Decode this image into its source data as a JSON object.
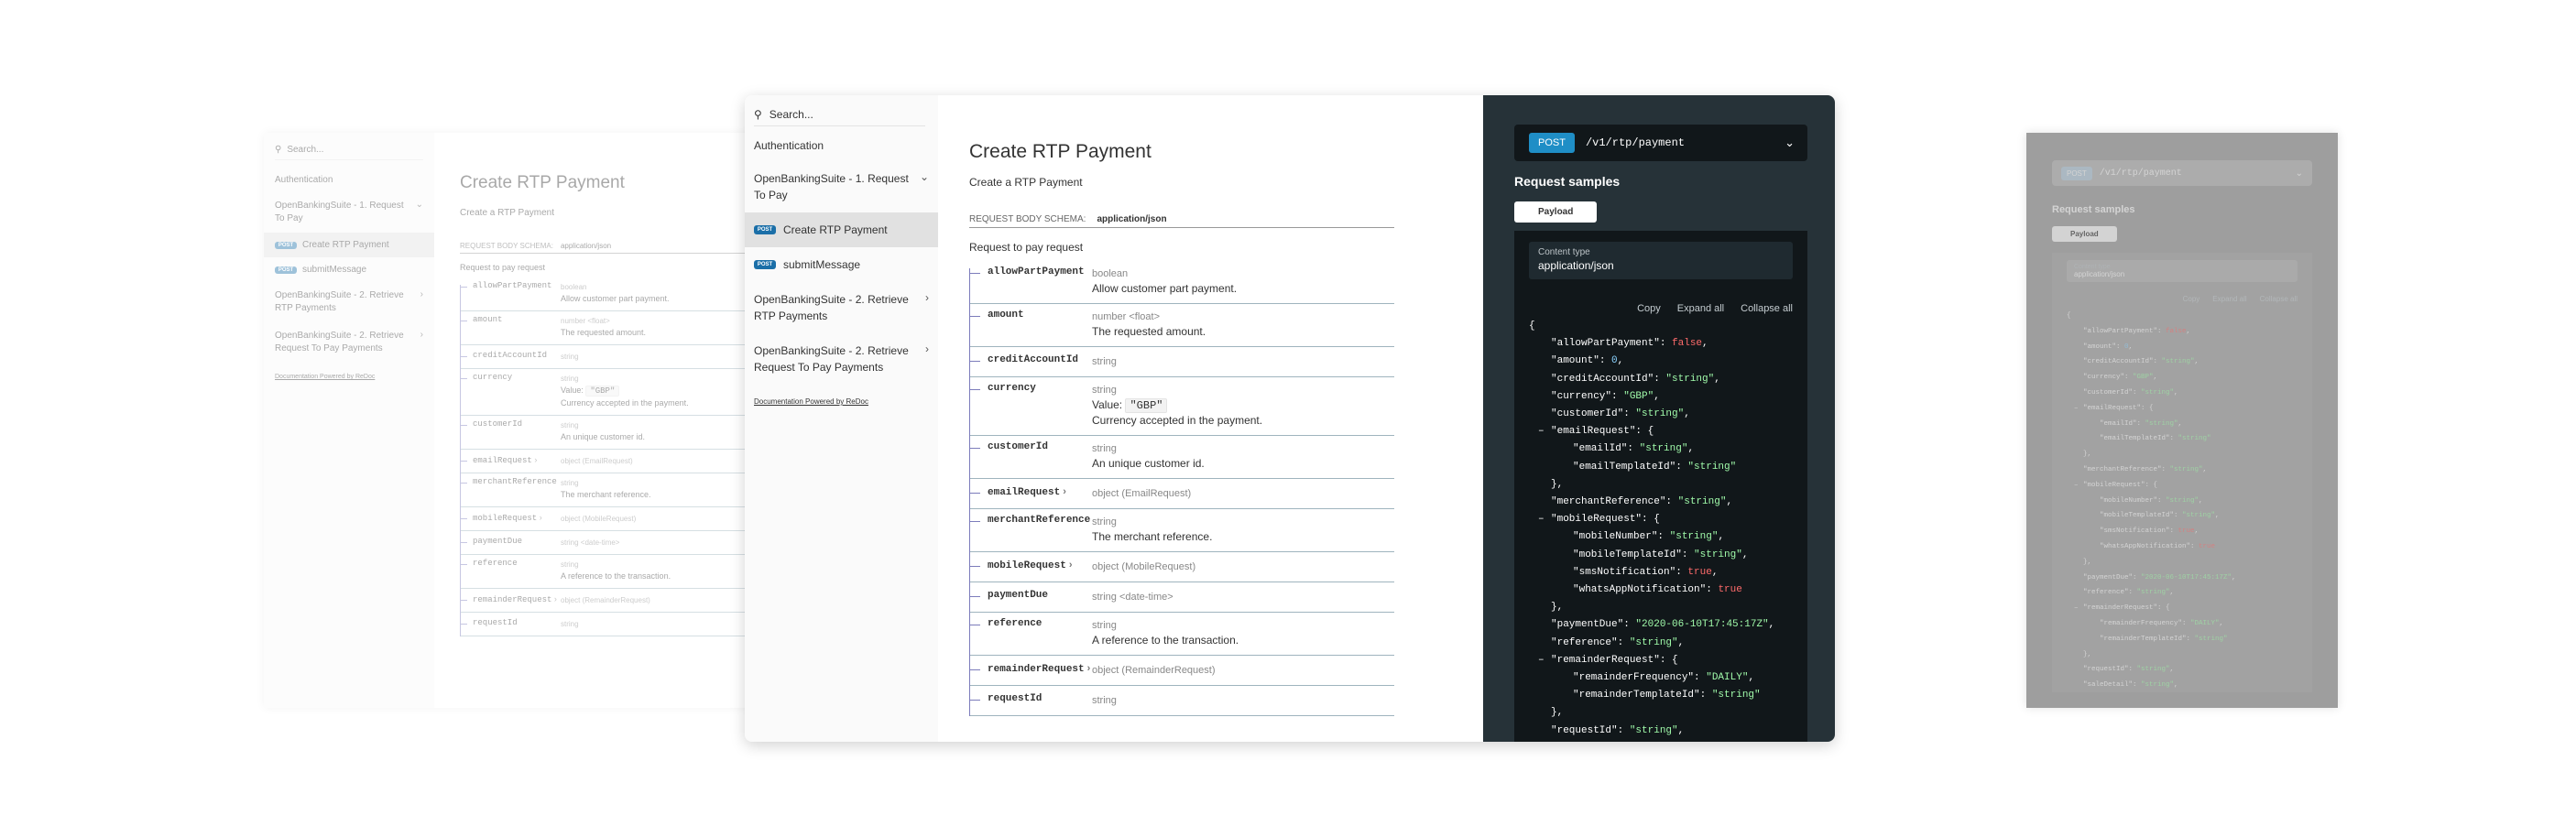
{
  "search_placeholder": "Search...",
  "menu": {
    "authentication": "Authentication",
    "group1": "OpenBankingSuite - 1. Request To Pay",
    "create_rtp": "Create RTP Payment",
    "submit_message": "submitMessage",
    "group2a": "OpenBankingSuite - 2. Retrieve RTP Payments",
    "group2b": "OpenBankingSuite - 2. Retrieve Request To Pay Payments",
    "post_badge": "POST",
    "powered_by": "Documentation Powered by ReDoc"
  },
  "main": {
    "title": "Create RTP Payment",
    "subtitle": "Create a RTP Payment",
    "schema_label": "REQUEST BODY SCHEMA:",
    "schema_value": "application/json",
    "request_desc": "Request to pay request",
    "props": [
      {
        "name": "allowPartPayment",
        "type": "boolean",
        "desc": "Allow customer part payment."
      },
      {
        "name": "amount",
        "type": "number <float>",
        "desc": "The requested amount."
      },
      {
        "name": "creditAccountId",
        "type": "string",
        "desc": ""
      },
      {
        "name": "currency",
        "type": "string",
        "value_label": "Value:",
        "value": "\"GBP\"",
        "desc": "Currency accepted in the payment."
      },
      {
        "name": "customerId",
        "type": "string",
        "desc": "An unique customer id."
      },
      {
        "name": "emailRequest",
        "type": "object (EmailRequest)",
        "desc": ""
      },
      {
        "name": "merchantReference",
        "type": "string",
        "desc": "The merchant reference."
      },
      {
        "name": "mobileRequest",
        "type": "object (MobileRequest)",
        "desc": ""
      },
      {
        "name": "paymentDue",
        "type": "string <date-time>",
        "desc": ""
      },
      {
        "name": "reference",
        "type": "string",
        "desc": "A reference to the transaction."
      },
      {
        "name": "remainderRequest",
        "type": "object (RemainderRequest)",
        "desc": ""
      },
      {
        "name": "requestId",
        "type": "string",
        "desc": ""
      }
    ]
  },
  "panel": {
    "method": "POST",
    "path": "/v1/rtp/payment",
    "samples_title": "Request samples",
    "tab": "Payload",
    "content_type_label": "Content type",
    "content_type": "application/json",
    "copy": "Copy",
    "expand_all": "Expand all",
    "collapse_all": "Collapse all"
  },
  "json_lines": [
    {
      "i": 0,
      "t": "{"
    },
    {
      "i": 1,
      "k": "\"allowPartPayment\"",
      "v": "false",
      "vt": "b",
      "comma": true
    },
    {
      "i": 1,
      "k": "\"amount\"",
      "v": "0",
      "vt": "n",
      "comma": true
    },
    {
      "i": 1,
      "k": "\"creditAccountId\"",
      "v": "\"string\"",
      "vt": "s",
      "comma": true
    },
    {
      "i": 1,
      "k": "\"currency\"",
      "v": "\"GBP\"",
      "vt": "s",
      "comma": true
    },
    {
      "i": 1,
      "k": "\"customerId\"",
      "v": "\"string\"",
      "vt": "s",
      "comma": true
    },
    {
      "i": 1,
      "toggle": true,
      "k": "\"emailRequest\"",
      "v": "{",
      "vt": "p"
    },
    {
      "i": 2,
      "k": "\"emailId\"",
      "v": "\"string\"",
      "vt": "s",
      "comma": true
    },
    {
      "i": 2,
      "k": "\"emailTemplateId\"",
      "v": "\"string\"",
      "vt": "s"
    },
    {
      "i": 1,
      "t": "},"
    },
    {
      "i": 1,
      "k": "\"merchantReference\"",
      "v": "\"string\"",
      "vt": "s",
      "comma": true
    },
    {
      "i": 1,
      "toggle": true,
      "k": "\"mobileRequest\"",
      "v": "{",
      "vt": "p"
    },
    {
      "i": 2,
      "k": "\"mobileNumber\"",
      "v": "\"string\"",
      "vt": "s",
      "comma": true
    },
    {
      "i": 2,
      "k": "\"mobileTemplateId\"",
      "v": "\"string\"",
      "vt": "s",
      "comma": true
    },
    {
      "i": 2,
      "k": "\"smsNotification\"",
      "v": "true",
      "vt": "b",
      "comma": true
    },
    {
      "i": 2,
      "k": "\"whatsAppNotification\"",
      "v": "true",
      "vt": "b"
    },
    {
      "i": 1,
      "t": "},"
    },
    {
      "i": 1,
      "k": "\"paymentDue\"",
      "v": "\"2020-06-10T17:45:17Z\"",
      "vt": "s",
      "comma": true
    },
    {
      "i": 1,
      "k": "\"reference\"",
      "v": "\"string\"",
      "vt": "s",
      "comma": true
    },
    {
      "i": 1,
      "toggle": true,
      "k": "\"remainderRequest\"",
      "v": "{",
      "vt": "p"
    },
    {
      "i": 2,
      "k": "\"remainderFrequency\"",
      "v": "\"DAILY\"",
      "vt": "s",
      "comma": true
    },
    {
      "i": 2,
      "k": "\"remainderTemplateId\"",
      "v": "\"string\"",
      "vt": "s"
    },
    {
      "i": 1,
      "t": "},"
    },
    {
      "i": 1,
      "k": "\"requestId\"",
      "v": "\"string\"",
      "vt": "s",
      "comma": true
    },
    {
      "i": 1,
      "k": "\"saleDetail\"",
      "v": "\"string\"",
      "vt": "s",
      "comma": true
    }
  ],
  "colors": {
    "post_badge": "#1f8ec6",
    "dark_panel": "#263238",
    "code_bg": "#11171a",
    "string": "#a0fbaa",
    "boolean": "#ff6b6b",
    "tree_line": "#7c7cbb"
  }
}
